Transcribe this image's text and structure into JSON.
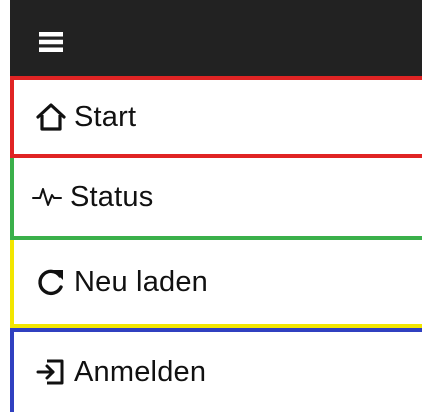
{
  "header": {
    "menu_icon": "hamburger-menu-icon",
    "background": "#222222"
  },
  "menu": {
    "items": [
      {
        "label": "Start",
        "icon": "home-icon",
        "border_color": "#e02424"
      },
      {
        "label": "Status",
        "icon": "pulse-icon",
        "border_color": "#3ab04a"
      },
      {
        "label": "Neu laden",
        "icon": "reload-icon",
        "border_color": "#f2e600"
      },
      {
        "label": "Anmelden",
        "icon": "sign-in-icon",
        "border_color": "#3040c0"
      }
    ]
  }
}
